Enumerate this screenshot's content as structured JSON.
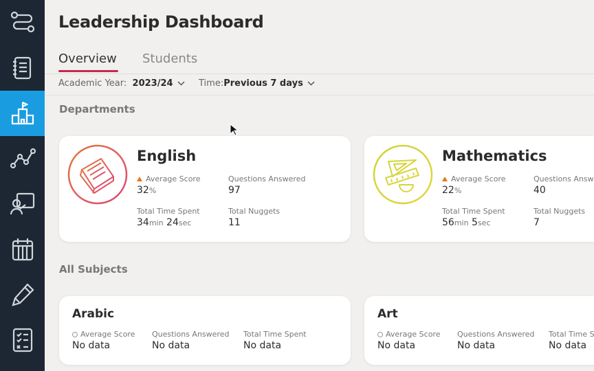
{
  "app": {
    "title": "Leadership Dashboard"
  },
  "sidebar": {
    "items": [
      {
        "name": "sidebar-item-pathways",
        "icon": "pathway-icon"
      },
      {
        "name": "sidebar-item-notes",
        "icon": "notebook-icon"
      },
      {
        "name": "sidebar-item-school",
        "icon": "school-icon",
        "active": true
      },
      {
        "name": "sidebar-item-analytics",
        "icon": "line-chart-icon"
      },
      {
        "name": "sidebar-item-teaching",
        "icon": "teacher-board-icon"
      },
      {
        "name": "sidebar-item-calendar",
        "icon": "calendar-icon"
      },
      {
        "name": "sidebar-item-edit",
        "icon": "pencil-icon"
      },
      {
        "name": "sidebar-item-tasks",
        "icon": "checklist-icon"
      }
    ],
    "active_color": "#1a9de0",
    "background": "#1c2733"
  },
  "tabs": [
    {
      "label": "Overview",
      "active": true
    },
    {
      "label": "Students",
      "active": false
    }
  ],
  "filters": {
    "academic_year": {
      "label": "Academic Year:",
      "value": "2023/24"
    },
    "time": {
      "label": "Time:",
      "value": "Previous 7 days"
    }
  },
  "sections": {
    "departments": "Departments",
    "all_subjects": "All Subjects"
  },
  "departments": [
    {
      "name": "English",
      "icon": "book-icon",
      "avg_label": "Average Score",
      "avg_value": "32",
      "avg_unit": "%",
      "qa_label": "Questions Answered",
      "qa_value": "97",
      "time_label": "Total Time Spent",
      "time_min": "34",
      "time_min_unit": "min",
      "time_sec": "24",
      "time_sec_unit": "sec",
      "nuggets_label": "Total Nuggets",
      "nuggets_value": "11"
    },
    {
      "name": "Mathematics",
      "icon": "geometry-tools-icon",
      "avg_label": "Average Score",
      "avg_value": "22",
      "avg_unit": "%",
      "qa_label": "Questions Answered",
      "qa_value": "40",
      "time_label": "Total Time Spent",
      "time_min": "56",
      "time_min_unit": "min",
      "time_sec": "5",
      "time_sec_unit": "sec",
      "nuggets_label": "Total Nuggets",
      "nuggets_value": "7"
    }
  ],
  "subjects": [
    {
      "name": "Arabic",
      "avg_label": "Average Score",
      "avg_value": "No data",
      "qa_label": "Questions Answered",
      "qa_value": "No data",
      "time_label": "Total Time Spent",
      "time_value": "No data"
    },
    {
      "name": "Art",
      "avg_label": "Average Score",
      "avg_value": "No data",
      "qa_label": "Questions Answered",
      "qa_value": "No data",
      "time_label": "Total Time Spent",
      "time_value": "No data"
    }
  ],
  "colors": {
    "accent_tab": "#c9284a",
    "trend_up": "#e3761e",
    "english_gradient": [
      "#e07a3c",
      "#e0457a"
    ],
    "math_gradient": [
      "#c9d63a",
      "#e6d43c"
    ]
  }
}
